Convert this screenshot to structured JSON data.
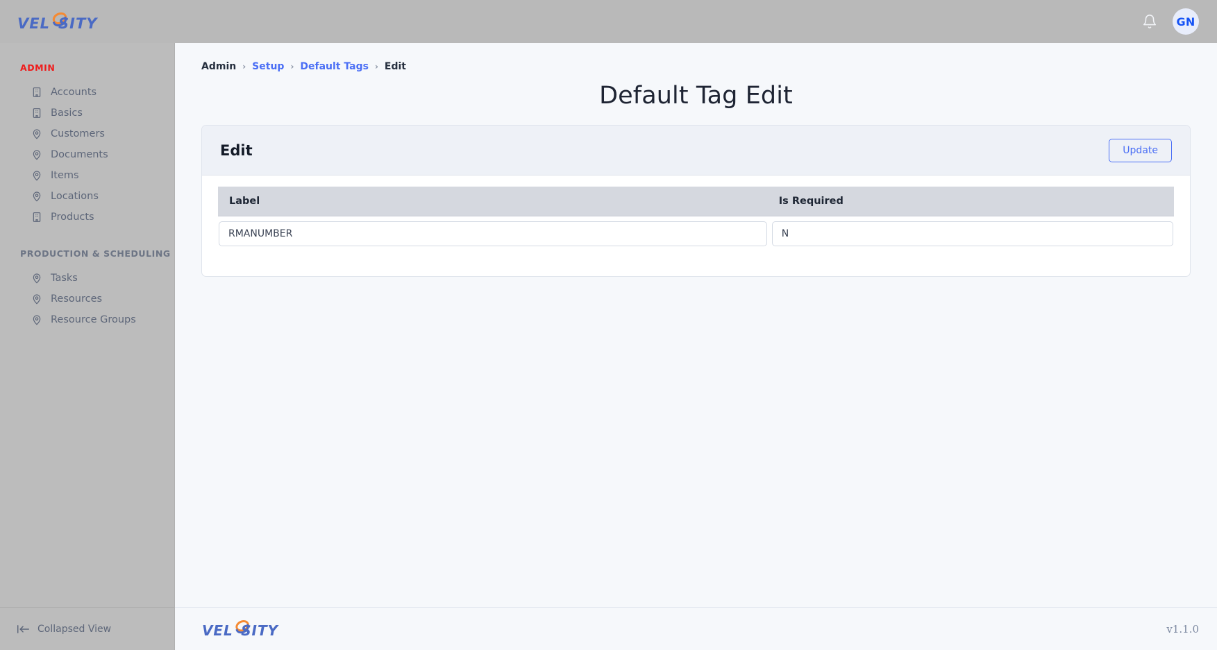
{
  "app": {
    "logo_text": "VELOSITY",
    "logo_color": "#4a6ac4",
    "logo_accent_color": "#f58a33"
  },
  "topbar": {
    "notifications_icon": "bell-icon",
    "avatar_initials": "GN",
    "avatar_color": "#1452f5",
    "avatar_bg": "#e8edfb"
  },
  "sidebar": {
    "sections": [
      {
        "title": "ADMIN",
        "title_color": "#ef1b1b",
        "items": [
          {
            "label": "Accounts",
            "icon": "building-icon"
          },
          {
            "label": "Basics",
            "icon": "building-icon"
          },
          {
            "label": "Customers",
            "icon": "map-pin-icon"
          },
          {
            "label": "Documents",
            "icon": "map-pin-icon"
          },
          {
            "label": "Items",
            "icon": "map-pin-icon"
          },
          {
            "label": "Locations",
            "icon": "map-pin-icon"
          },
          {
            "label": "Products",
            "icon": "building-icon"
          }
        ]
      },
      {
        "title": "PRODUCTION & SCHEDULING",
        "title_color": "#6d7585",
        "items": [
          {
            "label": "Tasks",
            "icon": "map-pin-icon"
          },
          {
            "label": "Resources",
            "icon": "map-pin-icon"
          },
          {
            "label": "Resource Groups",
            "icon": "map-pin-icon"
          }
        ]
      }
    ],
    "collapse_label": "Collapsed View",
    "collapse_icon": "collapse-left-icon"
  },
  "breadcrumb": [
    {
      "label": "Admin",
      "link": false
    },
    {
      "label": "Setup",
      "link": true
    },
    {
      "label": "Default Tags",
      "link": true
    },
    {
      "label": "Edit",
      "link": false
    }
  ],
  "breadcrumb_separator": "›",
  "page": {
    "title": "Default Tag Edit"
  },
  "card": {
    "title": "Edit",
    "update_label": "Update",
    "accent_color": "#4a6ef5"
  },
  "table": {
    "columns": [
      "Label",
      "Is Required"
    ],
    "rows": [
      {
        "label": "RMANUMBER",
        "is_required": "N"
      }
    ]
  },
  "footer": {
    "version": "v1.1.0"
  }
}
